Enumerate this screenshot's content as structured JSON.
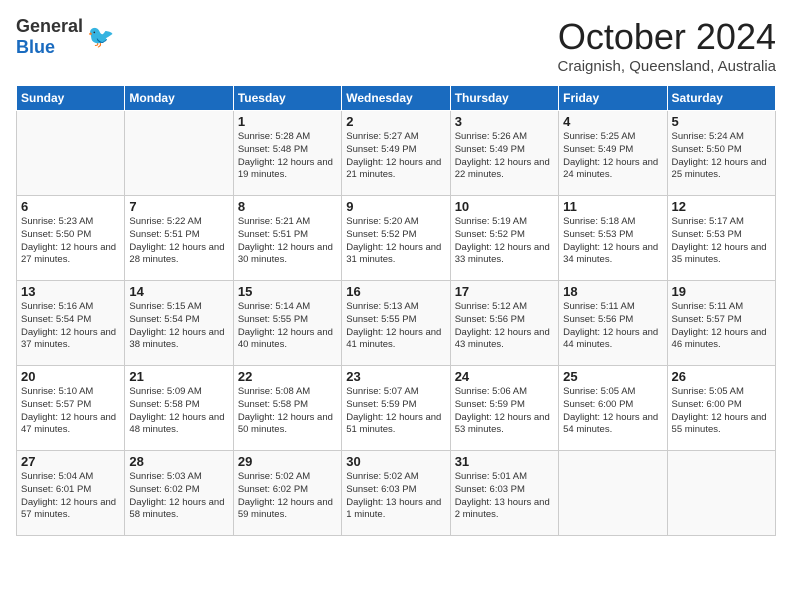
{
  "header": {
    "logo_general": "General",
    "logo_blue": "Blue",
    "title": "October 2024",
    "subtitle": "Craignish, Queensland, Australia"
  },
  "columns": [
    "Sunday",
    "Monday",
    "Tuesday",
    "Wednesday",
    "Thursday",
    "Friday",
    "Saturday"
  ],
  "weeks": [
    {
      "days": [
        {
          "num": "",
          "info": ""
        },
        {
          "num": "",
          "info": ""
        },
        {
          "num": "1",
          "info": "Sunrise: 5:28 AM\nSunset: 5:48 PM\nDaylight: 12 hours and 19 minutes."
        },
        {
          "num": "2",
          "info": "Sunrise: 5:27 AM\nSunset: 5:49 PM\nDaylight: 12 hours and 21 minutes."
        },
        {
          "num": "3",
          "info": "Sunrise: 5:26 AM\nSunset: 5:49 PM\nDaylight: 12 hours and 22 minutes."
        },
        {
          "num": "4",
          "info": "Sunrise: 5:25 AM\nSunset: 5:49 PM\nDaylight: 12 hours and 24 minutes."
        },
        {
          "num": "5",
          "info": "Sunrise: 5:24 AM\nSunset: 5:50 PM\nDaylight: 12 hours and 25 minutes."
        }
      ]
    },
    {
      "days": [
        {
          "num": "6",
          "info": "Sunrise: 5:23 AM\nSunset: 5:50 PM\nDaylight: 12 hours and 27 minutes."
        },
        {
          "num": "7",
          "info": "Sunrise: 5:22 AM\nSunset: 5:51 PM\nDaylight: 12 hours and 28 minutes."
        },
        {
          "num": "8",
          "info": "Sunrise: 5:21 AM\nSunset: 5:51 PM\nDaylight: 12 hours and 30 minutes."
        },
        {
          "num": "9",
          "info": "Sunrise: 5:20 AM\nSunset: 5:52 PM\nDaylight: 12 hours and 31 minutes."
        },
        {
          "num": "10",
          "info": "Sunrise: 5:19 AM\nSunset: 5:52 PM\nDaylight: 12 hours and 33 minutes."
        },
        {
          "num": "11",
          "info": "Sunrise: 5:18 AM\nSunset: 5:53 PM\nDaylight: 12 hours and 34 minutes."
        },
        {
          "num": "12",
          "info": "Sunrise: 5:17 AM\nSunset: 5:53 PM\nDaylight: 12 hours and 35 minutes."
        }
      ]
    },
    {
      "days": [
        {
          "num": "13",
          "info": "Sunrise: 5:16 AM\nSunset: 5:54 PM\nDaylight: 12 hours and 37 minutes."
        },
        {
          "num": "14",
          "info": "Sunrise: 5:15 AM\nSunset: 5:54 PM\nDaylight: 12 hours and 38 minutes."
        },
        {
          "num": "15",
          "info": "Sunrise: 5:14 AM\nSunset: 5:55 PM\nDaylight: 12 hours and 40 minutes."
        },
        {
          "num": "16",
          "info": "Sunrise: 5:13 AM\nSunset: 5:55 PM\nDaylight: 12 hours and 41 minutes."
        },
        {
          "num": "17",
          "info": "Sunrise: 5:12 AM\nSunset: 5:56 PM\nDaylight: 12 hours and 43 minutes."
        },
        {
          "num": "18",
          "info": "Sunrise: 5:11 AM\nSunset: 5:56 PM\nDaylight: 12 hours and 44 minutes."
        },
        {
          "num": "19",
          "info": "Sunrise: 5:11 AM\nSunset: 5:57 PM\nDaylight: 12 hours and 46 minutes."
        }
      ]
    },
    {
      "days": [
        {
          "num": "20",
          "info": "Sunrise: 5:10 AM\nSunset: 5:57 PM\nDaylight: 12 hours and 47 minutes."
        },
        {
          "num": "21",
          "info": "Sunrise: 5:09 AM\nSunset: 5:58 PM\nDaylight: 12 hours and 48 minutes."
        },
        {
          "num": "22",
          "info": "Sunrise: 5:08 AM\nSunset: 5:58 PM\nDaylight: 12 hours and 50 minutes."
        },
        {
          "num": "23",
          "info": "Sunrise: 5:07 AM\nSunset: 5:59 PM\nDaylight: 12 hours and 51 minutes."
        },
        {
          "num": "24",
          "info": "Sunrise: 5:06 AM\nSunset: 5:59 PM\nDaylight: 12 hours and 53 minutes."
        },
        {
          "num": "25",
          "info": "Sunrise: 5:05 AM\nSunset: 6:00 PM\nDaylight: 12 hours and 54 minutes."
        },
        {
          "num": "26",
          "info": "Sunrise: 5:05 AM\nSunset: 6:00 PM\nDaylight: 12 hours and 55 minutes."
        }
      ]
    },
    {
      "days": [
        {
          "num": "27",
          "info": "Sunrise: 5:04 AM\nSunset: 6:01 PM\nDaylight: 12 hours and 57 minutes."
        },
        {
          "num": "28",
          "info": "Sunrise: 5:03 AM\nSunset: 6:02 PM\nDaylight: 12 hours and 58 minutes."
        },
        {
          "num": "29",
          "info": "Sunrise: 5:02 AM\nSunset: 6:02 PM\nDaylight: 12 hours and 59 minutes."
        },
        {
          "num": "30",
          "info": "Sunrise: 5:02 AM\nSunset: 6:03 PM\nDaylight: 13 hours and 1 minute."
        },
        {
          "num": "31",
          "info": "Sunrise: 5:01 AM\nSunset: 6:03 PM\nDaylight: 13 hours and 2 minutes."
        },
        {
          "num": "",
          "info": ""
        },
        {
          "num": "",
          "info": ""
        }
      ]
    }
  ]
}
